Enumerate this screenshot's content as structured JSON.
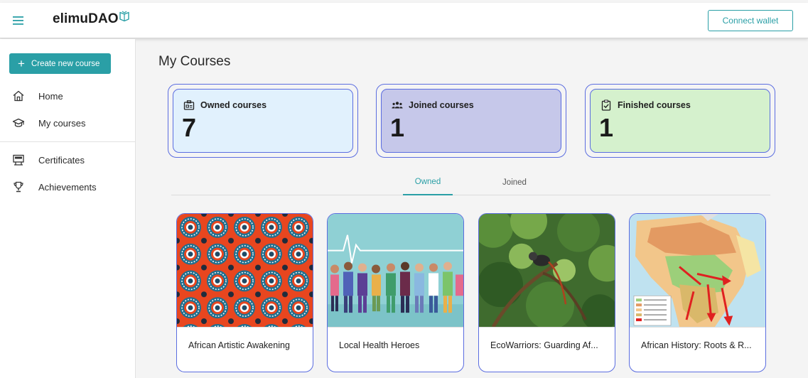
{
  "header": {
    "brand": "elimuDAO",
    "connect_label": "Connect wallet"
  },
  "sidebar": {
    "create_label": "Create new course",
    "items": [
      {
        "label": "Home",
        "icon": "home-icon"
      },
      {
        "label": "My courses",
        "icon": "graduation-cap-icon"
      },
      {
        "label": "Certificates",
        "icon": "certificate-icon"
      },
      {
        "label": "Achievements",
        "icon": "trophy-icon"
      }
    ]
  },
  "main": {
    "title": "My Courses",
    "stats": [
      {
        "label": "Owned courses",
        "value": "7",
        "color": "#e1f1fd",
        "icon": "badge-icon"
      },
      {
        "label": "Joined courses",
        "value": "1",
        "color": "#c6c8ea",
        "icon": "group-icon"
      },
      {
        "label": "Finished courses",
        "value": "1",
        "color": "#d5f1cd",
        "icon": "clipboard-check-icon"
      }
    ],
    "tabs": [
      {
        "label": "Owned",
        "active": true
      },
      {
        "label": "Joined",
        "active": false
      }
    ],
    "courses": [
      {
        "title": "African Artistic Awakening"
      },
      {
        "title": "Local Health Heroes"
      },
      {
        "title": "EcoWarriors: Guarding Af..."
      },
      {
        "title": "African History: Roots & R..."
      }
    ]
  },
  "colors": {
    "accent": "#2a9fa6",
    "card_border": "#5b6de0"
  }
}
